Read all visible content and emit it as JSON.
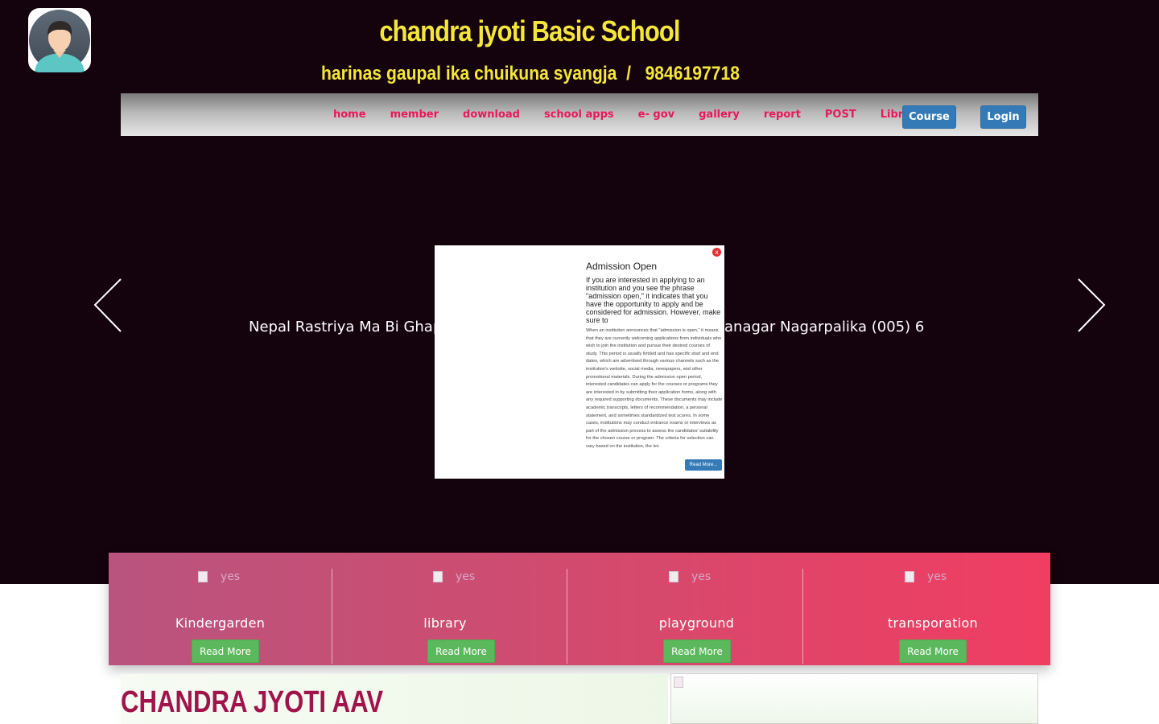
{
  "header": {
    "school_name": "chandra jyoti Basic School",
    "address_phone": "harinas gaupal ika chuikuna syangja  /   9846197718"
  },
  "nav": {
    "links": [
      "home",
      "member",
      "download",
      "school apps",
      "e- gov",
      "gallery",
      "report",
      "POST",
      "Library"
    ],
    "course_label": "Course",
    "login_label": "Login"
  },
  "slider": {
    "caption": "Nepal Rastriya Ma Bi Ghap... Chandranagar Nagarpalika (005) 6",
    "caption_left": "Nepal Rastriya Ma Bi Ghap",
    "caption_right": "anagar Nagarpalika (005) 6"
  },
  "popup": {
    "close_label": "x",
    "title": "Admission Open",
    "lead": "If you are interested in applying to an institution and you see the phrase \"admission open,\" it indicates that you have the opportunity to apply and be considered for admission. However, make sure to",
    "body": "When an institution announces that \"admission is open,\" it means that they are currently welcoming applications from individuals who wish to join the institution and pursue their desired courses of study. This period is usually limited and has specific start and end dates, which are advertised through various channels such as the institution's website, social media, newspapers, and other promotional materials. During the admission open period, interested candidates can apply for the courses or programs they are interested in by submitting their application forms, along with any required supporting documents. These documents may include academic transcripts, letters of recommendation, a personal statement, and sometimes standardized test scores. In some cases, institutions may conduct entrance exams or interviews as part of the admission process to assess the candidates' suitability for the chosen course or program. The criteria for selection can vary based on the institution, the lev",
    "read_more_label": "Read More..."
  },
  "features": [
    {
      "img_alt": "yes",
      "title": "Kindergarden",
      "button": "Read More"
    },
    {
      "img_alt": "yes",
      "title": "library",
      "button": "Read More"
    },
    {
      "img_alt": "yes",
      "title": "playground",
      "button": "Read More"
    },
    {
      "img_alt": "yes",
      "title": "transporation",
      "button": "Read More"
    }
  ],
  "about": {
    "heading": "CHANDRA JYOTI AAV"
  },
  "colors": {
    "hero_bg": "#14020c",
    "title_yellow": "#f4e63a",
    "nav_link": "#e8185a",
    "primary_button": "#337ab7",
    "success_button": "#5cb85c",
    "heading": "#a0144b"
  },
  "icons": {
    "logo": "user-avatar-icon",
    "prev": "chevron-left-icon",
    "next": "chevron-right-icon",
    "popup_close": "close-icon",
    "feature_image": "broken-image-icon"
  }
}
